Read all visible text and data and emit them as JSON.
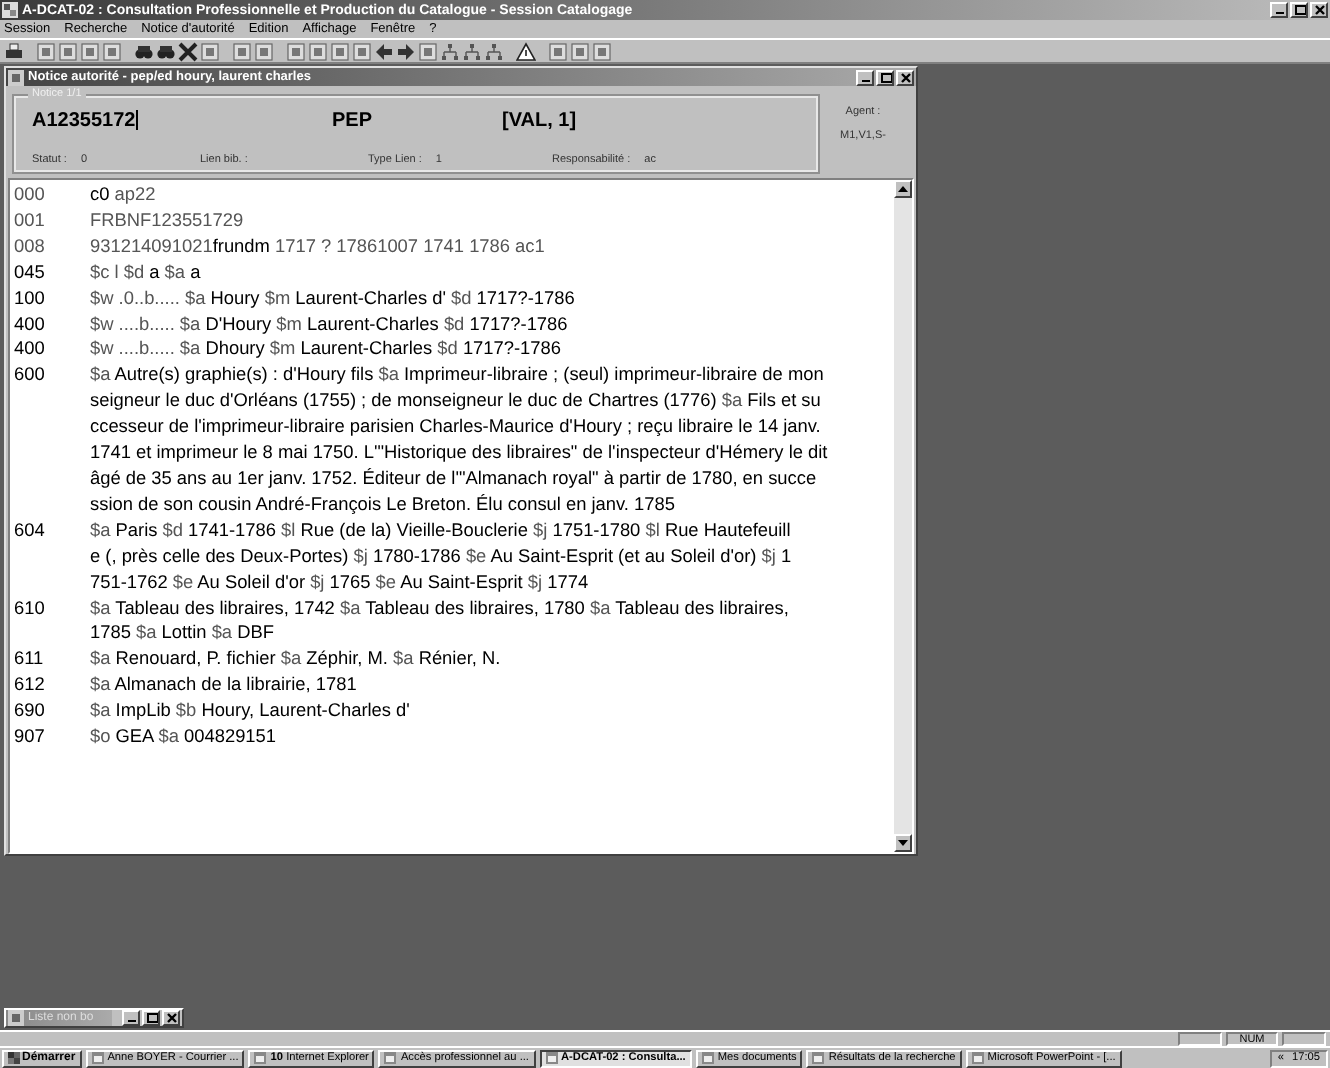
{
  "window": {
    "title": "A-DCAT-02 : Consultation Professionnelle et Production du Catalogue - Session Catalogage"
  },
  "menu": [
    "Session",
    "Recherche",
    "Notice d'autorité",
    "Edition",
    "Affichage",
    "Fenêtre",
    "?"
  ],
  "child_window": {
    "title": "Notice autorité - pep/ed houry, laurent charles",
    "header": {
      "group_label": "Notice 1/1",
      "number": "A12355172",
      "code": "PEP",
      "validation": "[VAL, 1]",
      "fields": [
        {
          "label": "Statut :",
          "value": "0"
        },
        {
          "label": "Lien bib. :"
        },
        {
          "label": "Type Lien :",
          "value": "1"
        },
        {
          "label": "Responsabilité :",
          "value": "ac"
        }
      ],
      "agent_label": "Agent :",
      "agent_value": "M1,V1,S-"
    },
    "record": [
      {
        "tag": "000",
        "kind": "control",
        "lines": [
          "**c0** ap22"
        ]
      },
      {
        "tag": "001",
        "kind": "control",
        "lines": [
          "FRBNF123551729"
        ]
      },
      {
        "tag": "008",
        "kind": "control",
        "lines": [
          "931214091021**frundm**       1717    ? 17861007 1741 1786   ac1"
        ]
      },
      {
        "tag": "045",
        "kind": "data",
        "lines": [
          "$c l   $d **a**   $a **a**"
        ]
      },
      {
        "tag": "100",
        "kind": "data",
        "lines": [
          "$w .0..b.....   $a **Houry**   $m **Laurent-Charles d'**   $d **1717?-1786**"
        ]
      },
      {
        "tag": "400",
        "kind": "data",
        "lines": [
          "$w ....b.....   $a **D'Houry**   $m **Laurent-Charles**   $d **1717?-1786**"
        ]
      },
      {
        "tag": "400",
        "kind": "data",
        "lines": [
          "$w ....b.....   $a **Dhoury**   $m **Laurent-Charles**   $d **1717?-1786**"
        ]
      },
      {
        "tag": "600",
        "kind": "data",
        "lines": [
          "$a **Autre(s) graphie(s) : d'Houry fils**   $a **Imprimeur-libraire ; (seul) imprimeur-libraire de mon**",
          "**seigneur le duc d'Orléans (1755) ; de monseigneur le duc de Chartres (1776)**   $a **Fils et su**",
          "**ccesseur de l'imprimeur-libraire parisien Charles-Maurice d'Houry ; reçu libraire le 14 janv.**",
          "**1741 et imprimeur le 8 mai 1750. L'\"Historique des libraires\" de l'inspecteur d'Hémery le dit**",
          " **âgé de 35 ans au 1er janv. 1752. Éditeur de l'\"Almanach royal\" à partir de 1780,  en succe**",
          "**ssion de son cousin André-François Le Breton. Élu consul en janv. 1785**"
        ]
      },
      {
        "tag": "604",
        "kind": "data",
        "lines": [
          "$a **Paris**   $d **1741-1786**   $l **Rue (de la) Vieille-Bouclerie**   $j **1751-1780**   $l **Rue Hautefeuill**",
          "**e (, près celle des Deux-Portes)**   $j **1780-1786**   $e **Au Saint-Esprit (et au Soleil d'or)**   $j **1**",
          "**751-1762**   $e **Au Soleil d'or**   $j **1765**   $e **Au Saint-Esprit**   $j **1774**"
        ]
      },
      {
        "tag": "610",
        "kind": "data",
        "lines": [
          "$a **Tableau des libraires, 1742**   $a **Tableau des libraires, 1780**   $a **Tableau des libraires,**",
          "**1785**   $a **Lottin**   $a **DBF**"
        ]
      },
      {
        "tag": "611",
        "kind": "data",
        "lines": [
          "$a **Renouard, P. fichier**   $a **Zéphir, M.**   $a **Rénier, N.**"
        ]
      },
      {
        "tag": "612",
        "kind": "data",
        "lines": [
          "$a **Almanach de la librairie, 1781**"
        ]
      },
      {
        "tag": "690",
        "kind": "data",
        "lines": [
          "$a **ImpLib**   $b **Houry, Laurent-Charles d'**"
        ]
      },
      {
        "tag": "907",
        "kind": "data",
        "lines": [
          "$o **GEA**   $a **004829151**"
        ]
      }
    ]
  },
  "minimized_window": {
    "title": "Liste non bo"
  },
  "status_bar": {
    "indicator": "NUM"
  },
  "taskbar": {
    "start": "Démarrer",
    "items": [
      {
        "label": "Anne BOYER - Courrier ...",
        "selected": false
      },
      {
        "label": "**10** Internet Explorer",
        "selected": false
      },
      {
        "label": "Accès professionnel au ...",
        "selected": false
      },
      {
        "label": "A-DCAT-02 : Consulta...",
        "selected": true
      },
      {
        "label": "Mes documents",
        "selected": false
      },
      {
        "label": "Résultats de la recherche",
        "selected": false
      },
      {
        "label": "Microsoft PowerPoint - [...",
        "selected": false
      }
    ],
    "tray_arrow": "«",
    "clock": "17:05"
  }
}
